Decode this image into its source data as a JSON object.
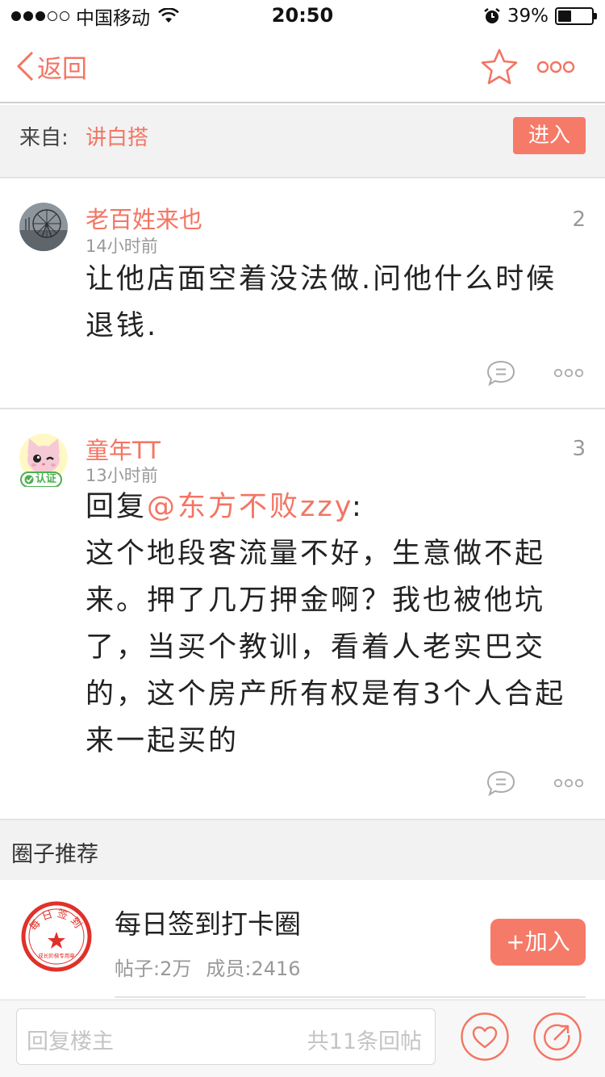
{
  "status_bar": {
    "carrier": "中国移动",
    "time": "20:50",
    "battery_percent": "39%",
    "battery_level": 0.39,
    "signal_strength": 3,
    "icons": [
      "wifi-icon",
      "alarm-icon",
      "battery-icon"
    ]
  },
  "nav": {
    "back_label": "返回",
    "icons": [
      "chevron-left-icon",
      "star-icon",
      "more-icon"
    ]
  },
  "source": {
    "label": "来自:",
    "name": "讲白搭",
    "enter_label": "进入"
  },
  "posts": [
    {
      "author": "老百姓来也",
      "time": "14小时前",
      "floor": "2",
      "content": "让他店面空着没法做.问他什么时候退钱."
    },
    {
      "author": "童年TT",
      "time": "13小时前",
      "floor": "3",
      "badge": "认证",
      "reply_prefix": "回复",
      "mention": "@东方不败zzy",
      "reply_suffix": ":",
      "content": "这个地段客流量不好，生意做不起来。押了几万押金啊？我也被他坑了，当买个教训，看着人老实巴交的，这个房产所有权是有3个人合起来一起买的"
    }
  ],
  "recommend": {
    "section_title": "圈子推荐",
    "circle": {
      "name": "每日签到打卡圈",
      "posts_label": "帖子:",
      "posts_value": "2万",
      "members_label": "成员:",
      "members_value": "2416",
      "join_label": "+加入",
      "logo_top_text": "每日签到",
      "logo_bottom_text": "成长阶梯专用章"
    }
  },
  "bottom": {
    "reply_placeholder": "回复楼主",
    "reply_count": "共11条回帖"
  },
  "colors": {
    "accent": "#f37563",
    "button": "#f57a68",
    "background_gray": "#f2f2f2",
    "stamp_red": "#e0312a"
  }
}
